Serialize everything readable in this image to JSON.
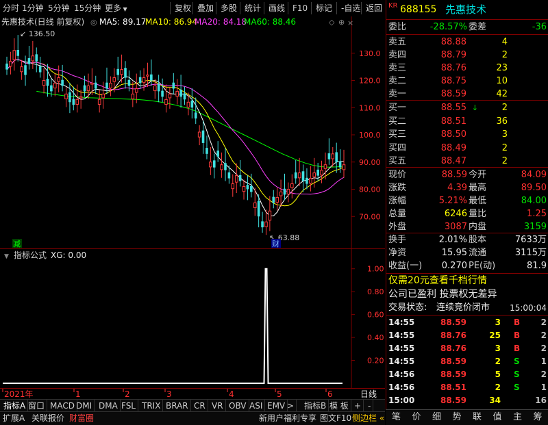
{
  "toolbar": {
    "items": [
      "分时",
      "1分钟",
      "5分钟",
      "15分钟",
      "更多",
      "复权",
      "叠加",
      "多股",
      "统计",
      "画线",
      "F10",
      "标记",
      "-自选",
      "返回"
    ]
  },
  "main_chart": {
    "title": "先惠技术(日线 前复权)",
    "ma": [
      {
        "label": "MA5: 89.17",
        "color": "#ffffff"
      },
      {
        "label": "MA10: 86.94",
        "color": "#ffff00"
      },
      {
        "label": "MA20: 84.18",
        "color": "#ff40ff"
      },
      {
        "label": "MA60: 88.46",
        "color": "#00ff00"
      }
    ],
    "high_label": "136.50",
    "low_label": "63.88",
    "jian_tag": "减",
    "cai_tag": "财",
    "y_ticks": [
      "130.0",
      "120.0",
      "110.0",
      "100.0",
      "90.00",
      "80.00",
      "70.00"
    ]
  },
  "indicator_chart": {
    "title": "指标公式",
    "legend": "XG: 0.00",
    "y_ticks": [
      "1.00",
      "0.80",
      "0.60",
      "0.40",
      "0.20"
    ]
  },
  "time_axis": {
    "labels": [
      "2021年",
      "1",
      "2",
      "3",
      "4",
      "5",
      "6"
    ],
    "right_label": "日线"
  },
  "indicator_tabs": [
    "指标A",
    "窗口",
    "MACD",
    "DMI",
    "DMA",
    "FSL",
    "TRIX",
    "BRAR",
    "CR",
    "VR",
    "OBV",
    "ASI",
    "EMV",
    ">",
    "指标B",
    "模 板",
    "+",
    "-"
  ],
  "bottom_bar": {
    "left": [
      "扩展A",
      "关联报价",
      "财富圈"
    ],
    "right": [
      "新用户福利专享",
      "图文F10",
      "侧边栏"
    ]
  },
  "quote": {
    "market_tag": "KR",
    "code": "688155",
    "name": "先惠技术",
    "weibi_label": "委比",
    "weibi_value": "-28.57%",
    "weicha_label": "委差",
    "weicha_value": "-36",
    "asks": [
      {
        "label": "卖五",
        "price": "88.88",
        "vol": "4"
      },
      {
        "label": "卖四",
        "price": "88.79",
        "vol": "2"
      },
      {
        "label": "卖三",
        "price": "88.76",
        "vol": "23"
      },
      {
        "label": "卖二",
        "price": "88.75",
        "vol": "10"
      },
      {
        "label": "卖一",
        "price": "88.59",
        "vol": "42"
      }
    ],
    "bids": [
      {
        "label": "买一",
        "price": "88.55",
        "vol": "2"
      },
      {
        "label": "买二",
        "price": "88.51",
        "vol": "36"
      },
      {
        "label": "买三",
        "price": "88.50",
        "vol": "3"
      },
      {
        "label": "买四",
        "price": "88.49",
        "vol": "2"
      },
      {
        "label": "买五",
        "price": "88.47",
        "vol": "2"
      }
    ],
    "stats": [
      {
        "l1": "现价",
        "v1": "88.59",
        "c1": "red",
        "l2": "今开",
        "v2": "84.09",
        "c2": "red"
      },
      {
        "l1": "涨跌",
        "v1": "4.39",
        "c1": "red",
        "l2": "最高",
        "v2": "89.50",
        "c2": "red"
      },
      {
        "l1": "涨幅",
        "v1": "5.21%",
        "c1": "red",
        "l2": "最低",
        "v2": "84.00",
        "c2": "green"
      },
      {
        "l1": "总量",
        "v1": "6246",
        "c1": "yellow",
        "l2": "量比",
        "v2": "1.25",
        "c2": "red"
      },
      {
        "l1": "外盘",
        "v1": "3087",
        "c1": "red",
        "l2": "内盘",
        "v2": "3159",
        "c2": "green"
      }
    ],
    "stats2": [
      {
        "l1": "换手",
        "v1": "2.01%",
        "l2": "股本",
        "v2": "7633万"
      },
      {
        "l1": "净资",
        "v1": "15.95",
        "l2": "流通",
        "v2": "3115万"
      },
      {
        "l1": "收益(一)",
        "v1": "0.270",
        "l2": "PE(动)",
        "v2": "81.9"
      }
    ],
    "promo": "仅需20元查看千档行情",
    "notice": "公司已盈利 投票权无差异",
    "status_label": "交易状态:",
    "status_value": "连续竞价闭市",
    "status_time": "15:00:04",
    "trades": [
      {
        "t": "14:55",
        "p": "88.59",
        "v": "3",
        "bs": "B",
        "n": "2"
      },
      {
        "t": "14:55",
        "p": "88.76",
        "v": "25",
        "bs": "B",
        "n": "2"
      },
      {
        "t": "14:55",
        "p": "88.76",
        "v": "3",
        "bs": "B",
        "n": "2"
      },
      {
        "t": "14:55",
        "p": "88.59",
        "v": "2",
        "bs": "S",
        "n": "1"
      },
      {
        "t": "14:56",
        "p": "88.59",
        "v": "5",
        "bs": "S",
        "n": "2"
      },
      {
        "t": "14:56",
        "p": "88.51",
        "v": "2",
        "bs": "S",
        "n": "1"
      },
      {
        "t": "15:00",
        "p": "88.59",
        "v": "34",
        "bs": "",
        "n": "16"
      }
    ]
  },
  "right_tabs": [
    "笔",
    "价",
    "细",
    "势",
    "联",
    "值",
    "主",
    "筹"
  ],
  "chart_data": [
    {
      "type": "candlestick",
      "title": "先惠技术(日线 前复权)",
      "ylim": [
        60,
        140
      ],
      "x_labels": [
        "2021年",
        "1",
        "2",
        "3",
        "4",
        "5",
        "6"
      ],
      "annotations": [
        {
          "text": "136.50",
          "kind": "high"
        },
        {
          "text": "63.88",
          "kind": "low"
        }
      ],
      "ma_series": [
        {
          "name": "MA5",
          "last": 89.17
        },
        {
          "name": "MA10",
          "last": 86.94
        },
        {
          "name": "MA20",
          "last": 84.18
        },
        {
          "name": "MA60",
          "last": 88.46
        }
      ],
      "closes": [
        124,
        127,
        131,
        129,
        125,
        122,
        126,
        129,
        127,
        123,
        120,
        118,
        116,
        119,
        121,
        118,
        115,
        112,
        111,
        113,
        114,
        116,
        118,
        119,
        117,
        113,
        115,
        117,
        119,
        121,
        122,
        124,
        121,
        118,
        115,
        117,
        119,
        121,
        122,
        120,
        118,
        116,
        114,
        113,
        115,
        117,
        116,
        114,
        113,
        112,
        110,
        106,
        101,
        97,
        93,
        90,
        88,
        92,
        89,
        87,
        84,
        82,
        85,
        83,
        81,
        80,
        79,
        75,
        70,
        66,
        68,
        72,
        75,
        77,
        79,
        78,
        80,
        82,
        84,
        86,
        83,
        82,
        84,
        86,
        85,
        87,
        89,
        91,
        93,
        90,
        88,
        89
      ],
      "ma60_y": [
        116,
        115.5,
        115,
        114.6,
        114.2,
        114,
        113.8,
        113.6,
        113.5,
        113.4,
        113.3,
        113.2,
        113.1,
        113,
        112.8,
        112.5,
        112.1,
        111.6,
        111,
        110.3,
        109.5,
        108.4,
        107,
        105.6,
        104.2,
        102.8,
        101.4,
        100,
        98.6,
        97.2,
        95.8,
        94.4,
        93,
        91.8,
        90.6,
        89.6,
        88.8,
        88.3,
        88.1,
        88.2,
        88.46
      ]
    },
    {
      "type": "bar",
      "title": "指标公式",
      "series": [
        {
          "name": "XG",
          "last": 0.0
        }
      ],
      "ylim": [
        0,
        1.1
      ],
      "signal_index": 70
    }
  ]
}
